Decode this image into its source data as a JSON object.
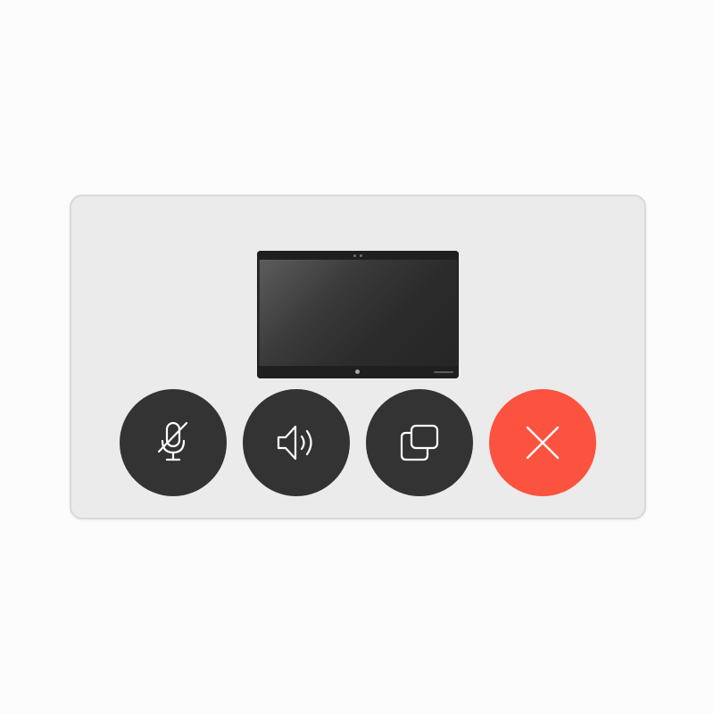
{
  "call_controls": {
    "device": {
      "name": "tablet-preview"
    },
    "buttons": [
      {
        "id": "mute",
        "icon": "microphone-muted-icon",
        "state": "muted",
        "color": "#333333"
      },
      {
        "id": "speaker",
        "icon": "speaker-volume-icon",
        "color": "#333333"
      },
      {
        "id": "share",
        "icon": "screen-share-icon",
        "color": "#333333"
      },
      {
        "id": "end-call",
        "icon": "close-icon",
        "color": "#fb5340"
      }
    ]
  },
  "colors": {
    "panel_bg": "#ebebeb",
    "button_dark": "#333333",
    "button_end": "#fb5340",
    "icon": "#ffffff"
  }
}
